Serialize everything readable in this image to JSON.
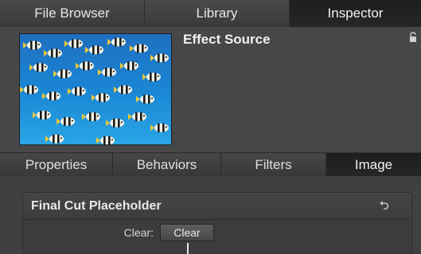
{
  "top_tabs": [
    {
      "label": "File Browser",
      "active": false
    },
    {
      "label": "Library",
      "active": false
    },
    {
      "label": "Inspector",
      "active": true
    }
  ],
  "header": {
    "title": "Effect Source",
    "thumbnail_icon": "fish-thumbnail-image",
    "lock_icon": "lock-icon"
  },
  "sub_tabs": [
    {
      "label": "Properties",
      "active": false
    },
    {
      "label": "Behaviors",
      "active": false
    },
    {
      "label": "Filters",
      "active": false
    },
    {
      "label": "Image",
      "active": true
    }
  ],
  "group": {
    "title": "Final Cut Placeholder",
    "reset_icon": "reset-arrow-icon",
    "params": [
      {
        "label": "Clear:",
        "button_label": "Clear"
      }
    ]
  },
  "colors": {
    "panel_bg": "#404040",
    "active_tab_bg": "#1e1e1e",
    "text": "#e6e6e6"
  }
}
